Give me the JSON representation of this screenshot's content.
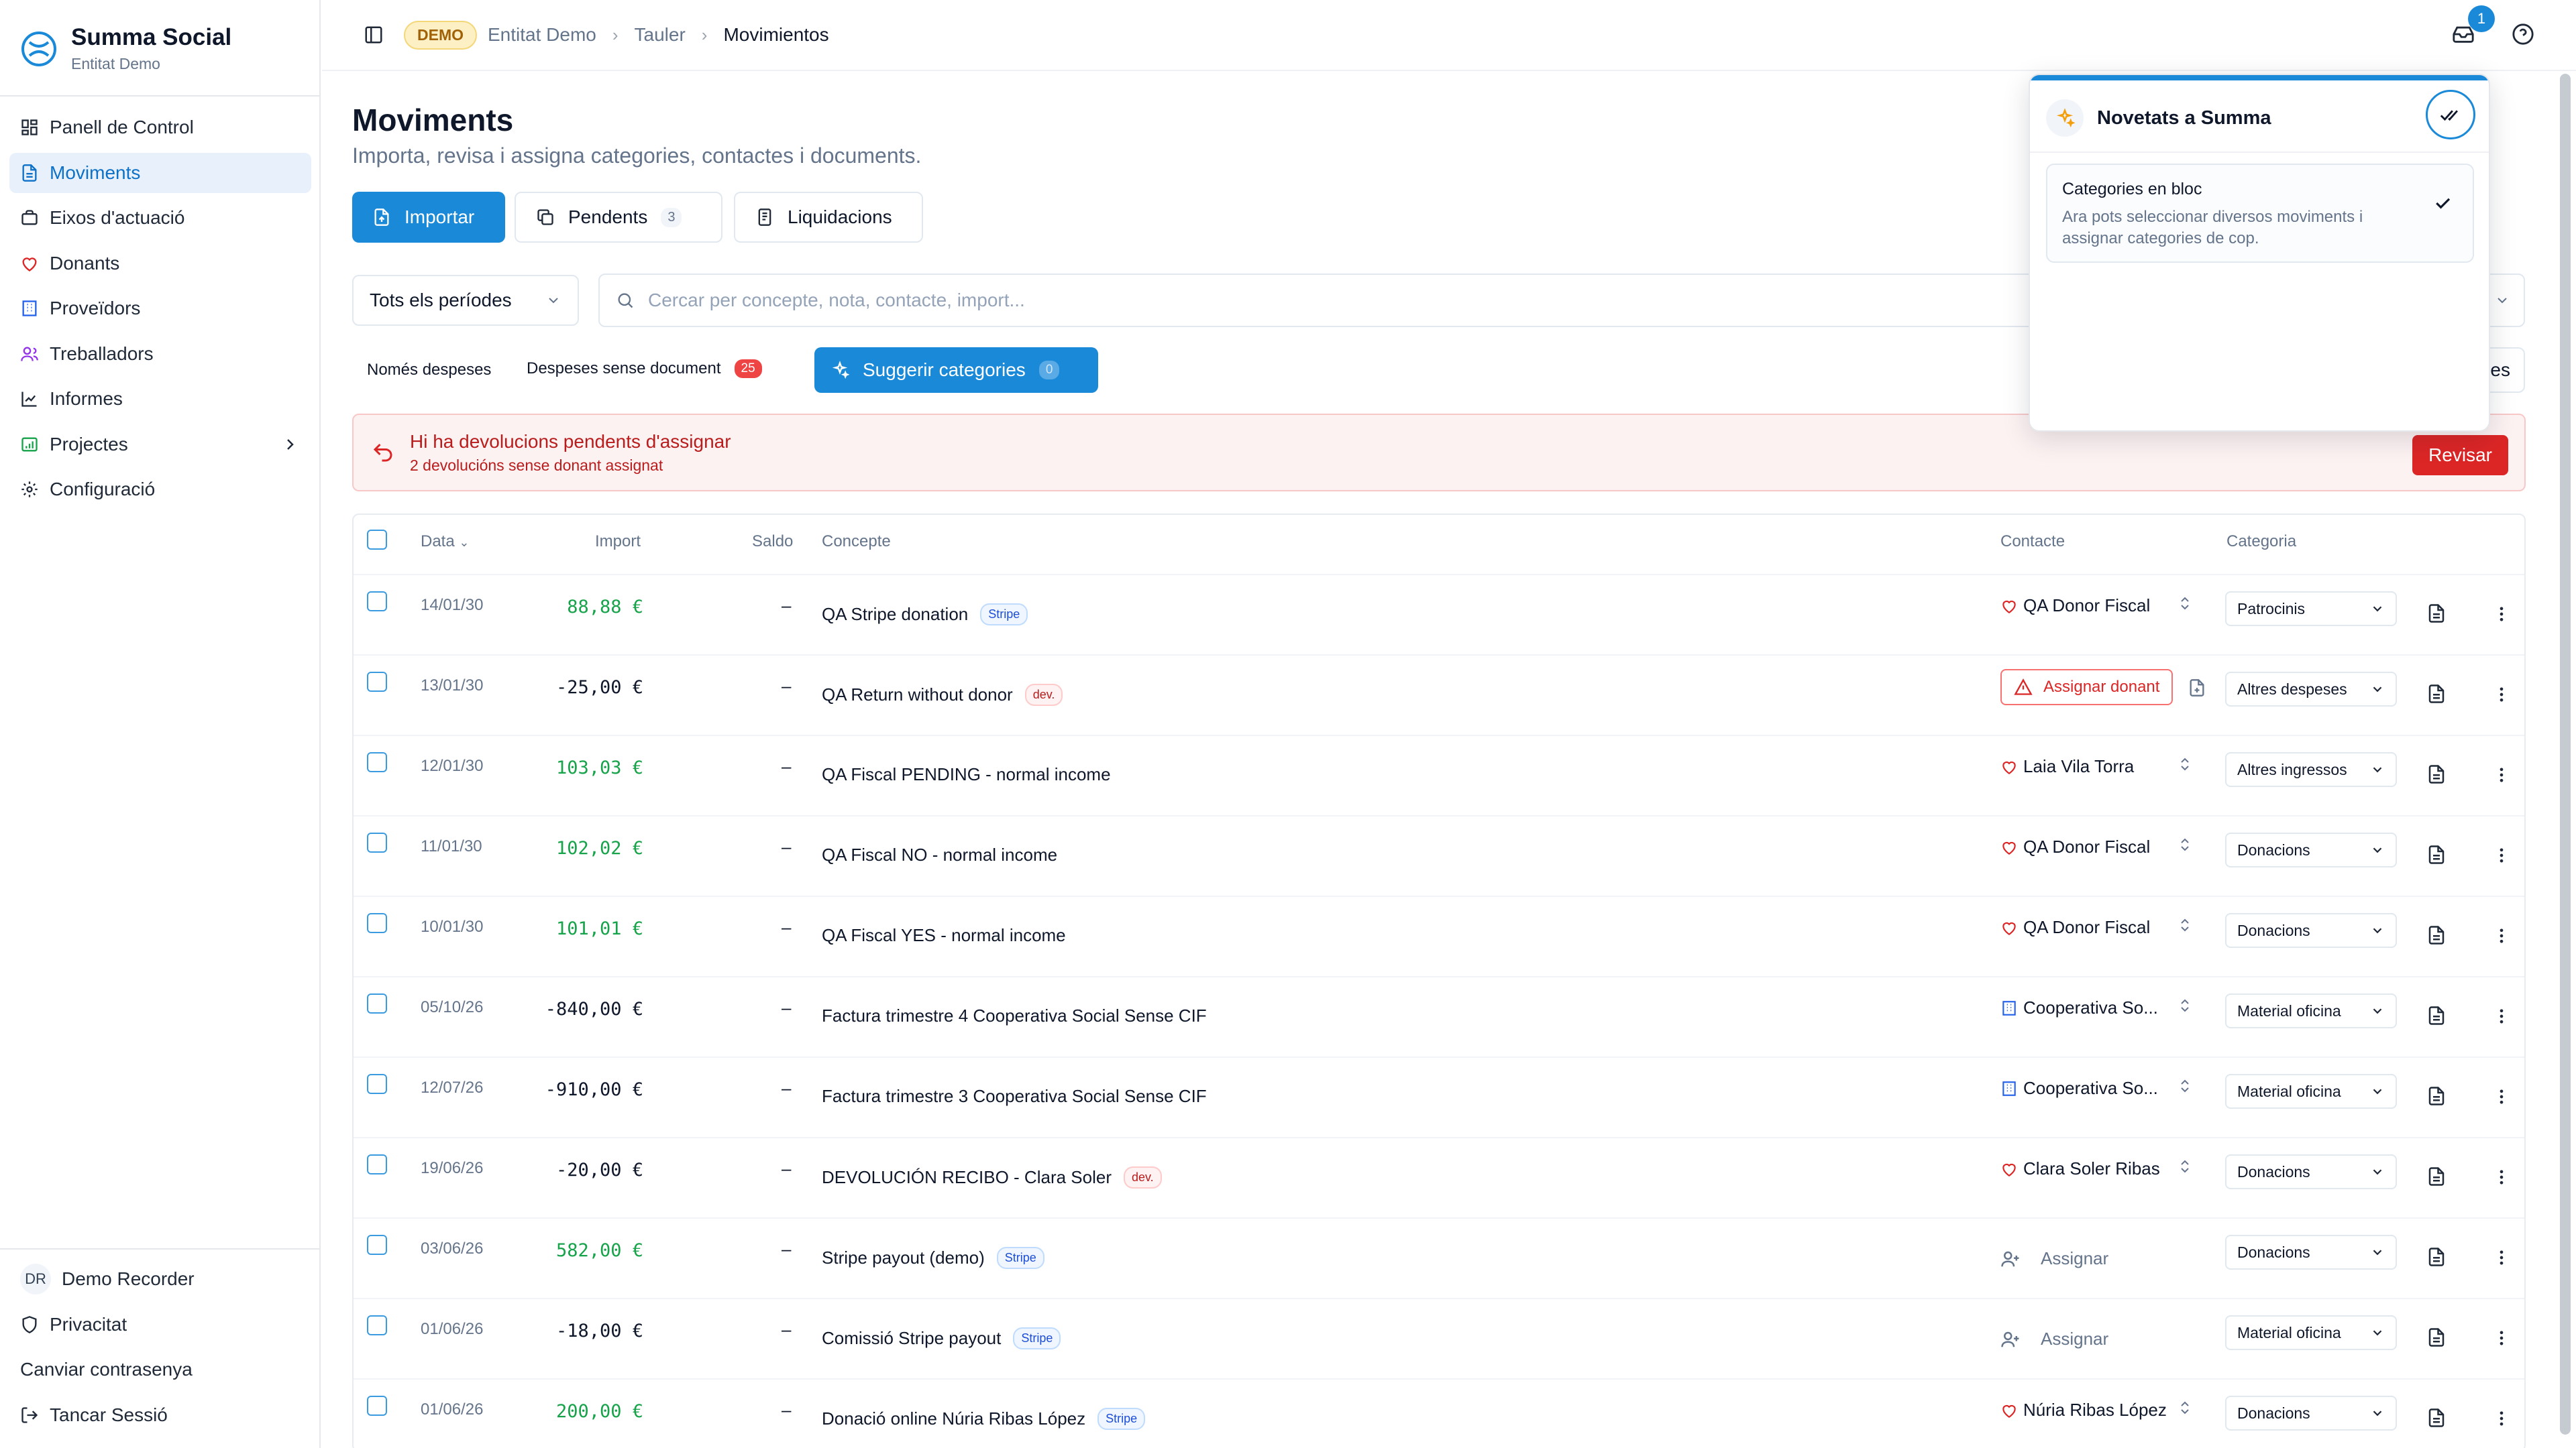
{
  "app": {
    "name": "Summa Social",
    "entity": "Entitat Demo"
  },
  "sidebar": {
    "items": [
      {
        "label": "Panell de Control",
        "icon": "dashboard-icon"
      },
      {
        "label": "Moviments",
        "icon": "document-icon"
      },
      {
        "label": "Eixos d'actuació",
        "icon": "briefcase-icon"
      },
      {
        "label": "Donants",
        "icon": "heart-icon"
      },
      {
        "label": "Proveïdors",
        "icon": "building-icon"
      },
      {
        "label": "Treballadors",
        "icon": "users-icon"
      },
      {
        "label": "Informes",
        "icon": "chart-icon"
      },
      {
        "label": "Projectes",
        "icon": "folder-icon"
      },
      {
        "label": "Configuració",
        "icon": "gear-icon"
      }
    ],
    "footer": {
      "avatar_initials": "DR",
      "user": "Demo Recorder",
      "privacy": "Privacitat",
      "change_password": "Canviar contrasenya",
      "logout": "Tancar Sessió"
    }
  },
  "topbar": {
    "badge": "DEMO",
    "breadcrumbs": [
      "Entitat Demo",
      "Tauler",
      "Movimientos"
    ],
    "notifications": "1"
  },
  "page": {
    "title": "Moviments",
    "subtitle": "Importa, revisa i assigna categories, contactes i documents.",
    "buttons": {
      "import": "Importar",
      "pending": "Pendents",
      "pending_count": "3",
      "settlements": "Liquidacions"
    },
    "period": "Tots els períodes",
    "search_placeholder": "Cercar per concepte, nota, contacte, import...",
    "filters": {
      "only_expenses": "Només despeses",
      "no_doc": "Despeses sense document",
      "no_doc_count": "25",
      "suggest": "Suggerir categories",
      "suggest_count": "0",
      "right_partial": "es"
    }
  },
  "alert": {
    "title": "Hi ha devolucions pendents d'assignar",
    "subtitle": "2 devolucións sense donant assignat",
    "button": "Revisar"
  },
  "table": {
    "headers": {
      "date": "Data",
      "amount": "Import",
      "balance": "Saldo",
      "concept": "Concepte",
      "contact": "Contacte",
      "category": "Categoria"
    },
    "rows": [
      {
        "date": "14/01/30",
        "amount": "88,88 €",
        "sign": "pos",
        "balance": "–",
        "concept": "QA Stripe donation",
        "tag": "Stripe",
        "tagType": "stripe",
        "contactType": "donor",
        "contact": "QA Donor Fiscal",
        "category": "Patrocinis"
      },
      {
        "date": "13/01/30",
        "amount": "-25,00 €",
        "sign": "neg",
        "balance": "–",
        "concept": "QA Return without donor",
        "tag": "dev.",
        "tagType": "dev",
        "contactType": "warn",
        "contact": "Assignar donant",
        "category": "Altres despeses"
      },
      {
        "date": "12/01/30",
        "amount": "103,03 €",
        "sign": "pos",
        "balance": "–",
        "concept": "QA Fiscal PENDING - normal income",
        "tag": "",
        "tagType": "",
        "contactType": "donor",
        "contact": "Laia Vila Torra",
        "category": "Altres ingressos"
      },
      {
        "date": "11/01/30",
        "amount": "102,02 €",
        "sign": "pos",
        "balance": "–",
        "concept": "QA Fiscal NO - normal income",
        "tag": "",
        "tagType": "",
        "contactType": "donor",
        "contact": "QA Donor Fiscal",
        "category": "Donacions"
      },
      {
        "date": "10/01/30",
        "amount": "101,01 €",
        "sign": "pos",
        "balance": "–",
        "concept": "QA Fiscal YES - normal income",
        "tag": "",
        "tagType": "",
        "contactType": "donor",
        "contact": "QA Donor Fiscal",
        "category": "Donacions"
      },
      {
        "date": "05/10/26",
        "amount": "-840,00 €",
        "sign": "neg",
        "balance": "–",
        "concept": "Factura trimestre 4 Cooperativa Social Sense CIF",
        "tag": "",
        "tagType": "",
        "contactType": "supplier",
        "contact": "Cooperativa So...",
        "category": "Material oficina"
      },
      {
        "date": "12/07/26",
        "amount": "-910,00 €",
        "sign": "neg",
        "balance": "–",
        "concept": "Factura trimestre 3 Cooperativa Social Sense CIF",
        "tag": "",
        "tagType": "",
        "contactType": "supplier",
        "contact": "Cooperativa So...",
        "category": "Material oficina"
      },
      {
        "date": "19/06/26",
        "amount": "-20,00 €",
        "sign": "neg",
        "balance": "–",
        "concept": "DEVOLUCIÓN RECIBO - Clara Soler",
        "tag": "dev.",
        "tagType": "dev",
        "contactType": "donor",
        "contact": "Clara Soler Ribas",
        "category": "Donacions"
      },
      {
        "date": "03/06/26",
        "amount": "582,00 €",
        "sign": "pos",
        "balance": "–",
        "concept": "Stripe payout (demo)",
        "tag": "Stripe",
        "tagType": "stripe",
        "contactType": "assign",
        "contact": "Assignar",
        "category": "Donacions"
      },
      {
        "date": "01/06/26",
        "amount": "-18,00 €",
        "sign": "neg",
        "balance": "–",
        "concept": "Comissió Stripe payout",
        "tag": "Stripe",
        "tagType": "stripe",
        "contactType": "assign",
        "contact": "Assignar",
        "category": "Material oficina"
      },
      {
        "date": "01/06/26",
        "amount": "200,00 €",
        "sign": "pos",
        "balance": "–",
        "concept": "Donació online Núria Ribas López",
        "tag": "Stripe",
        "tagType": "stripe",
        "contactType": "donor",
        "contact": "Núria Ribas López",
        "category": "Donacions"
      }
    ]
  },
  "popover": {
    "title": "Novetats a Summa",
    "card_title": "Categories en bloc",
    "card_text": "Ara pots seleccionar diversos moviments i assignar categories de cop."
  },
  "colors": {
    "accent": "#1a8ad8",
    "positive": "#16a34a",
    "danger": "#dc2626"
  }
}
